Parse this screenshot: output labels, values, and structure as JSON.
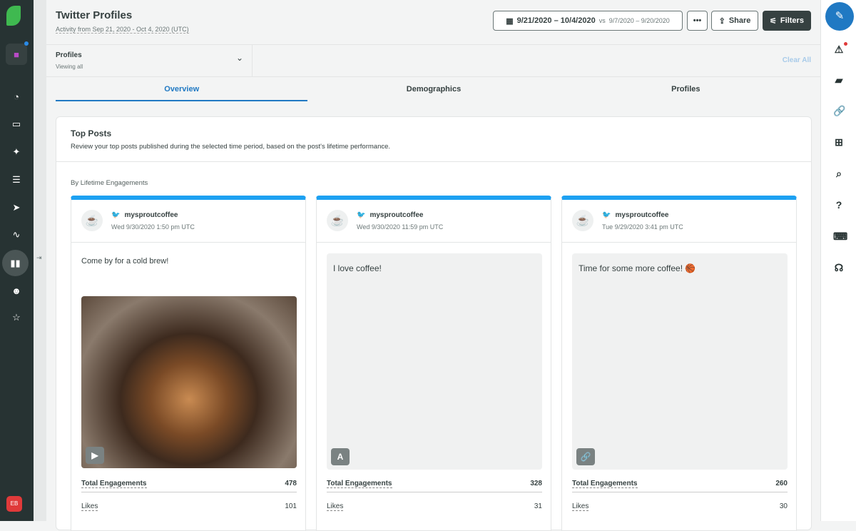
{
  "header": {
    "title": "Twitter Profiles",
    "subtitle": "Activity from Sep 21, 2020 - Oct 4, 2020 (UTC)",
    "date_range": "9/21/2020 – 10/4/2020",
    "compare_prefix": "vs",
    "compare_range": "9/7/2020 – 9/20/2020",
    "more_label": "•••",
    "share_label": "Share",
    "filters_label": "Filters"
  },
  "filter": {
    "label": "Profiles",
    "value": "Viewing all",
    "clear_all": "Clear All"
  },
  "tabs": [
    {
      "label": "Overview"
    },
    {
      "label": "Demographics"
    },
    {
      "label": "Profiles"
    }
  ],
  "section": {
    "title": "Top Posts",
    "description": "Review your top posts published during the selected time period, based on the post's lifetime performance.",
    "sort_label": "By Lifetime Engagements"
  },
  "user_initials": "EB",
  "posts": [
    {
      "username": "mysproutcoffee",
      "time": "Wed 9/30/2020 1:50 pm UTC",
      "text": "Come by for a cold brew!",
      "media_type": "video-icon",
      "stats": [
        {
          "label": "Total Engagements",
          "value": "478"
        },
        {
          "label": "Likes",
          "value": "101"
        }
      ]
    },
    {
      "username": "mysproutcoffee",
      "time": "Wed 9/30/2020 11:59 pm UTC",
      "text": "I love coffee!",
      "media_type": "text-icon",
      "type_glyph": "A",
      "stats": [
        {
          "label": "Total Engagements",
          "value": "328"
        },
        {
          "label": "Likes",
          "value": "31"
        }
      ]
    },
    {
      "username": "mysproutcoffee",
      "time": "Tue 9/29/2020 3:41 pm UTC",
      "text": "Time for some more coffee! 🏀",
      "media_type": "link-icon",
      "stats": [
        {
          "label": "Total Engagements",
          "value": "260"
        },
        {
          "label": "Likes",
          "value": "30"
        }
      ]
    }
  ],
  "colors": {
    "accent": "#2079c3",
    "twitter": "#1da1f2",
    "sidebar": "#273333"
  }
}
